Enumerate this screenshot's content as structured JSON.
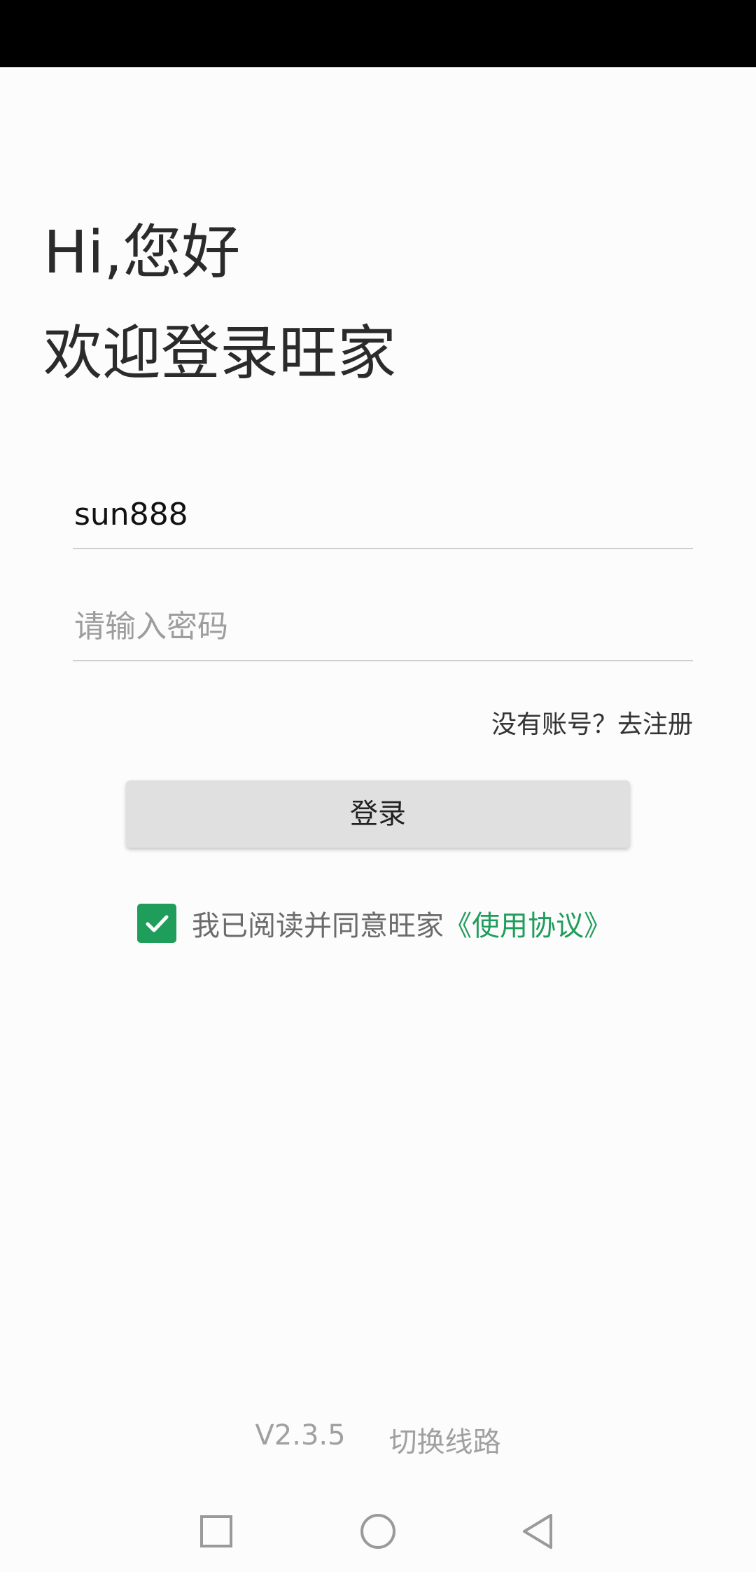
{
  "greeting": {
    "line1": "Hi,您好",
    "line2": "欢迎登录旺家"
  },
  "form": {
    "username_value": "sun888",
    "password_placeholder": "请输入密码",
    "register_link": "没有账号？去注册",
    "login_button": "登录"
  },
  "agreement": {
    "checked": true,
    "text": "我已阅读并同意旺家",
    "link": "《使用协议》"
  },
  "footer": {
    "version": "V2.3.5",
    "switch_route": "切换线路"
  },
  "colors": {
    "accent": "#1f9d5b",
    "status_bar": "#000000",
    "button_bg": "#e0e0e0"
  },
  "navigation": {
    "icons": [
      "recent-apps-icon",
      "home-icon",
      "back-icon"
    ]
  }
}
